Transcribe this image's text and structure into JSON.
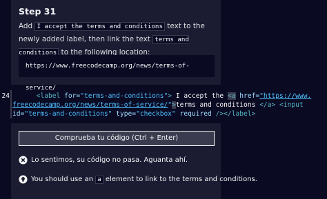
{
  "step": {
    "title": "Step 31"
  },
  "instructions": {
    "p1": "Add",
    "code1": "I accept the terms and conditions",
    "p2": "text to the newly added label, then link the text",
    "code2": "terms and conditions",
    "p3": "to the following location:",
    "url": "https://www.freecodecamp.org/news/terms-of-service/"
  },
  "editor": {
    "line_number": "24",
    "line1": {
      "indent": "      ",
      "open_label": "<label",
      "attr_for": "for=",
      "val_for": "\"terms-and-conditions\"",
      "close1": ">",
      "text1": " I accept the ",
      "a_open": "<a",
      "attr_href": " href=",
      "val_href1": "\"https://www."
    },
    "line2": {
      "val_href2": "freecodecamp.org/news/terms-of-service/",
      "quote_end": "\"",
      "close2": ">",
      "link_text": "terms and conditions",
      "a_close": "</a>",
      "input_open": " <input"
    },
    "line3": {
      "attr_id": "id=",
      "val_id": "\"terms-and-conditions\"",
      "attr_type": " type=",
      "val_type": "\"checkbox\"",
      "required": " required",
      "self_close": " /><",
      "label_close": "/label>"
    }
  },
  "actions": {
    "run_label": "Comprueba tu código (Ctrl + Enter)"
  },
  "feedback": {
    "fail_text": "Lo sentimos, su código no pasa. Aguanta ahí.",
    "hint_pre": "You should use an",
    "hint_code": "a",
    "hint_post": "element to link to the terms and conditions."
  },
  "colors": {
    "background": "#0a0a23",
    "panel": "#1b1b32",
    "tag": "#56b6c2",
    "string": "#4fc1ff"
  }
}
